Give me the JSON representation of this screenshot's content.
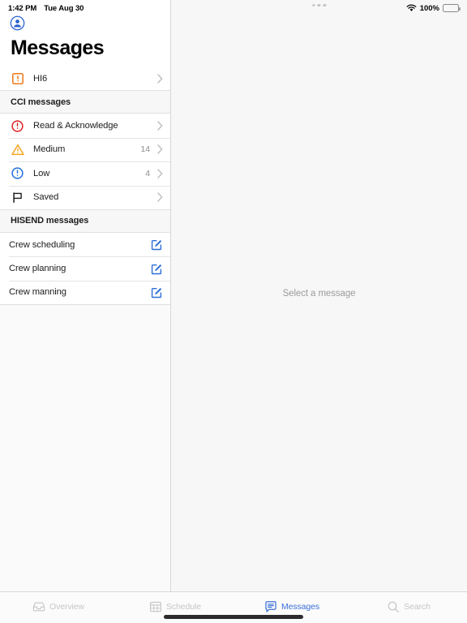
{
  "status_bar": {
    "time": "1:42 PM",
    "date": "Tue Aug 30",
    "battery_percent": "100%",
    "wifi_icon": "wifi-icon",
    "battery_icon": "battery-full-icon"
  },
  "sidebar": {
    "account_icon": "account-circle-icon",
    "title": "Messages",
    "top_rows": [
      {
        "label": "HI6",
        "icon": "exclamation-square-orange-icon",
        "count": "",
        "accessory": "chevron-right-icon"
      }
    ],
    "sections": [
      {
        "header": "CCI messages",
        "rows": [
          {
            "label": "Read & Acknowledge",
            "icon": "exclamation-circle-red-icon",
            "count": "",
            "accessory": "chevron-right-icon"
          },
          {
            "label": "Medium",
            "icon": "warning-triangle-amber-icon",
            "count": "14",
            "accessory": "chevron-right-icon"
          },
          {
            "label": "Low",
            "icon": "exclamation-circle-blue-icon",
            "count": "4",
            "accessory": "chevron-right-icon"
          },
          {
            "label": "Saved",
            "icon": "flag-outline-icon",
            "count": "",
            "accessory": "chevron-right-icon"
          }
        ]
      },
      {
        "header": "HISEND messages",
        "rows": [
          {
            "label": "Crew scheduling",
            "icon": "",
            "count": "",
            "accessory": "compose-icon"
          },
          {
            "label": "Crew planning",
            "icon": "",
            "count": "",
            "accessory": "compose-icon"
          },
          {
            "label": "Crew manning",
            "icon": "",
            "count": "",
            "accessory": "compose-icon"
          }
        ]
      }
    ]
  },
  "detail": {
    "multitasking_indicator": "multitasking-dots-icon",
    "empty_state_text": "Select a message"
  },
  "tabbar": {
    "tabs": [
      {
        "label": "Overview",
        "icon": "inbox-icon",
        "active": false
      },
      {
        "label": "Schedule",
        "icon": "calendar-grid-icon",
        "active": false
      },
      {
        "label": "Messages",
        "icon": "speech-bubble-icon",
        "active": true
      },
      {
        "label": "Search",
        "icon": "magnifier-icon",
        "active": false
      }
    ]
  },
  "colors": {
    "accent_blue": "#3a6fd8",
    "alert_red": "#e02020",
    "warn_amber": "#f5a623",
    "hi6_orange": "#f07818",
    "inactive_gray": "#c6c6c9",
    "separator": "#e4e4e6",
    "section_bg": "#f7f7f7"
  }
}
